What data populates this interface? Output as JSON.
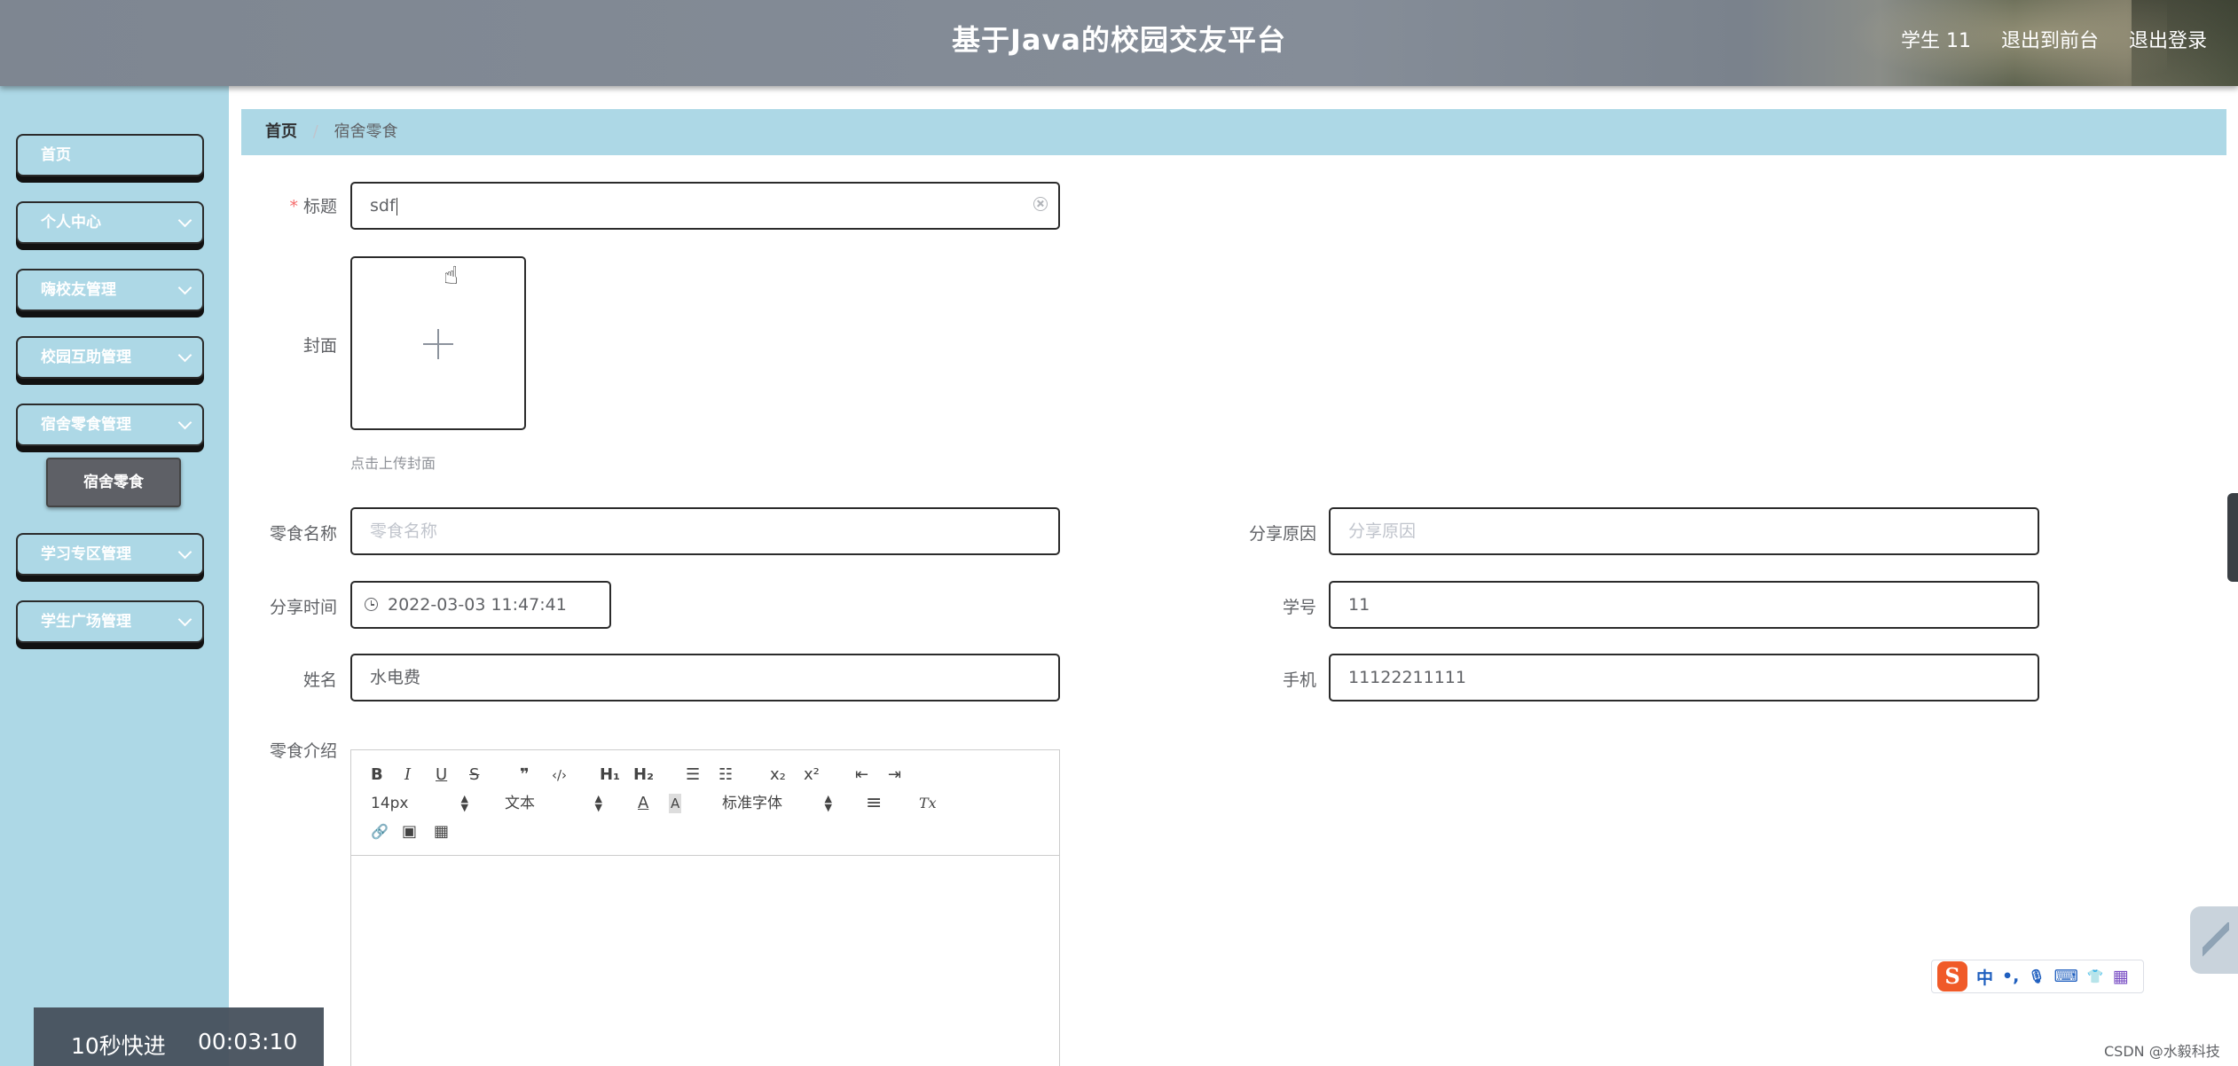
{
  "header": {
    "title": "基于Java的校园交友平台",
    "user_label": "学生 11",
    "back_to_front": "退出到前台",
    "logout": "退出登录"
  },
  "sidebar": {
    "items": [
      {
        "label": "首页",
        "has_children": false
      },
      {
        "label": "个人中心",
        "has_children": true
      },
      {
        "label": "嗨校友管理",
        "has_children": true
      },
      {
        "label": "校园互助管理",
        "has_children": true
      },
      {
        "label": "宿舍零食管理",
        "has_children": true,
        "expanded": true
      },
      {
        "label": "学习专区管理",
        "has_children": true
      },
      {
        "label": "学生广场管理",
        "has_children": true
      }
    ],
    "active_submenu": "宿舍零食"
  },
  "breadcrumb": {
    "home": "首页",
    "separator": "/",
    "current": "宿舍零食"
  },
  "form": {
    "title": {
      "label": "标题",
      "value": "sdf",
      "required": true
    },
    "cover": {
      "label": "封面",
      "tip": "点击上传封面"
    },
    "snack_name": {
      "label": "零食名称",
      "placeholder": "零食名称"
    },
    "share_reason": {
      "label": "分享原因",
      "placeholder": "分享原因"
    },
    "share_time": {
      "label": "分享时间",
      "value": "2022-03-03 11:47:41"
    },
    "student_no": {
      "label": "学号",
      "value": "11"
    },
    "name": {
      "label": "姓名",
      "value": "水电费"
    },
    "phone": {
      "label": "手机",
      "value": "11122211111"
    },
    "intro": {
      "label": "零食介绍"
    }
  },
  "editor": {
    "toolbar": {
      "bold": "B",
      "italic": "I",
      "underline": "U",
      "strike": "S",
      "quote": "❞",
      "code": "‹/›",
      "h1": "H₁",
      "h2": "H₂",
      "ordered_list": "☰",
      "bullet_list": "☷",
      "subscript": "x₂",
      "superscript": "x²",
      "outdent": "⇤",
      "indent": "⇥",
      "size": "14px",
      "header": "文本",
      "font": "标准字体",
      "color": "A",
      "background": "A",
      "align": "≡",
      "clean": "Tx",
      "link": "🔗",
      "image": "▣",
      "video": "▦"
    }
  },
  "overlays": {
    "video_label": "10秒快进",
    "video_time": "00:03:10",
    "ime_logo": "S",
    "ime_mode": "中",
    "ime_punct": "•,",
    "ime_mic": "🎙",
    "ime_keyboard": "⌨",
    "ime_skin": "👕",
    "ime_apps": "▦",
    "watermark": "CSDN @水毅科技"
  },
  "colors": {
    "sidebar_bg": "#add8e6",
    "header_bg": "#858d98",
    "active_submenu_bg": "#5e6066",
    "required": "#f56c6c"
  }
}
